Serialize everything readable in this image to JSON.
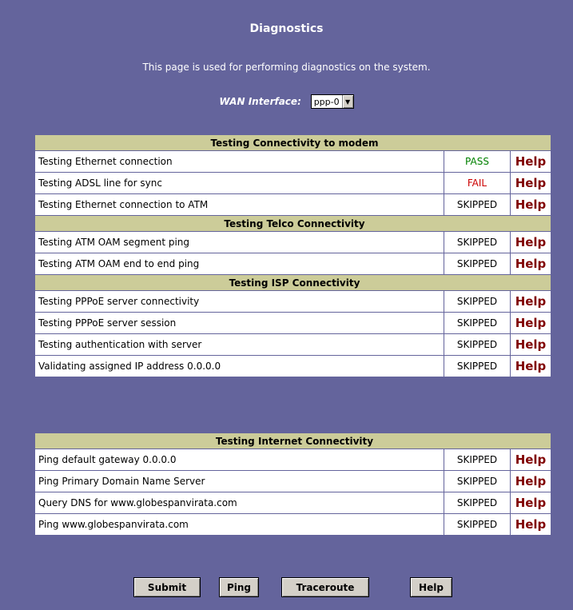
{
  "page": {
    "title": "Diagnostics",
    "description": "This page is used for performing diagnostics on the system.",
    "wan_label": "WAN Interface:",
    "wan_value": "ppp-0"
  },
  "colors": {
    "background": "#64649c",
    "section_header": "#cccc99",
    "pass": "#008000",
    "fail": "#cc0000",
    "help": "#800000"
  },
  "sections": [
    {
      "header": "Testing Connectivity to modem",
      "rows": [
        {
          "label": "Testing Ethernet connection",
          "status": "PASS",
          "help": "Help"
        },
        {
          "label": "Testing ADSL line for sync",
          "status": "FAIL",
          "help": "Help"
        },
        {
          "label": "Testing Ethernet connection to ATM",
          "status": "SKIPPED",
          "help": "Help"
        }
      ]
    },
    {
      "header": "Testing Telco Connectivity",
      "rows": [
        {
          "label": "Testing ATM OAM segment ping",
          "status": "SKIPPED",
          "help": "Help"
        },
        {
          "label": "Testing ATM OAM end to end ping",
          "status": "SKIPPED",
          "help": "Help"
        }
      ]
    },
    {
      "header": "Testing ISP Connectivity",
      "rows": [
        {
          "label": "Testing PPPoE server connectivity",
          "status": "SKIPPED",
          "help": "Help"
        },
        {
          "label": "Testing PPPoE server session",
          "status": "SKIPPED",
          "help": "Help"
        },
        {
          "label": "Testing authentication with server",
          "status": "SKIPPED",
          "help": "Help"
        },
        {
          "label": "Validating assigned IP address 0.0.0.0",
          "status": "SKIPPED",
          "help": "Help"
        }
      ]
    },
    {
      "header": "Testing Internet Connectivity",
      "rows": [
        {
          "label": "Ping default gateway 0.0.0.0",
          "status": "SKIPPED",
          "help": "Help"
        },
        {
          "label": "Ping Primary Domain Name Server",
          "status": "SKIPPED",
          "help": "Help"
        },
        {
          "label": "Query DNS for www.globespanvirata.com",
          "status": "SKIPPED",
          "help": "Help"
        },
        {
          "label": "Ping www.globespanvirata.com",
          "status": "SKIPPED",
          "help": "Help"
        }
      ]
    }
  ],
  "buttons": {
    "submit": "Submit",
    "ping": "Ping",
    "traceroute": "Traceroute",
    "help": "Help"
  }
}
